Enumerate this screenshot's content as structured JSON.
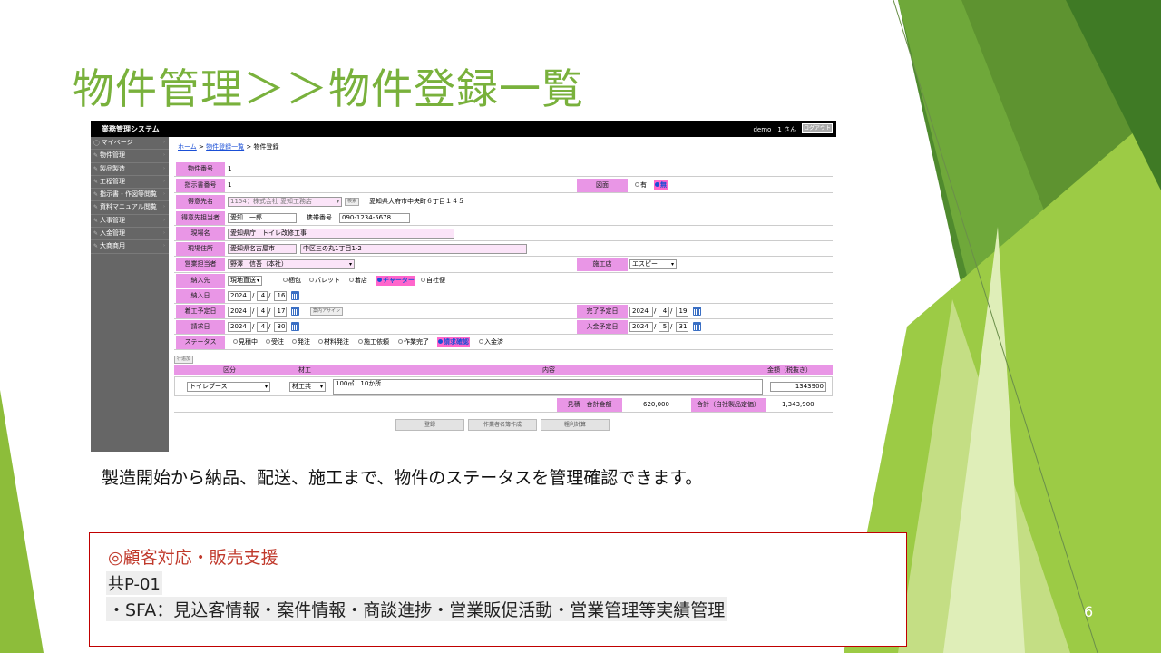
{
  "slide": {
    "title": "物件管理＞＞物件登録一覧",
    "caption": "製造開始から納品、配送、施工まで、物件のステータスを管理確認できます。",
    "note_heading": "◎顧客対応・販売支援",
    "note_code": "共P-01",
    "note_body": "・SFA：見込客情報・案件情報・商談進捗・営業販促活動・営業管理等実績管理",
    "page_number": "6",
    "accent_color": "#79b13c",
    "note_border_color": "#c00000"
  },
  "app": {
    "system_name": "業務管理システム",
    "user_label": "demo　1 さん",
    "logout_label": "ログアウト",
    "sidebar": [
      {
        "label": "マイページ"
      },
      {
        "label": "物件管理"
      },
      {
        "label": "製品製造"
      },
      {
        "label": "工程管理"
      },
      {
        "label": "指示書・作図等閲覧"
      },
      {
        "label": "資料マニュアル閲覧"
      },
      {
        "label": "人事管理"
      },
      {
        "label": "入金管理"
      },
      {
        "label": "大商商用"
      }
    ],
    "breadcrumb": {
      "home": "ホーム",
      "sep": ">",
      "list": "物件登録一覧",
      "current": "物件登録"
    },
    "form": {
      "property_no_label": "物件番号",
      "property_no": "1",
      "instruction_no_label": "指示書番号",
      "instruction_no": "1",
      "drawing_label": "図面",
      "drawing_yes": "有",
      "drawing_no": "無",
      "client_label": "得意先名",
      "client_value": "1154：株式会社 愛知工務店",
      "client_search": "検索",
      "client_address": "愛知県大府市中央町６丁目１４５",
      "client_person_label": "得意先担当者",
      "client_person": "愛知　一郎",
      "mobile_label": "携帯番号",
      "mobile": "090-1234-5678",
      "site_name_label": "現場名",
      "site_name": "愛知県庁　トイレ改修工事",
      "site_address_label": "現場住所",
      "site_city": "愛知県名古屋市",
      "site_street": "中区三の丸1丁目1-2",
      "sales_person_label": "営業担当者",
      "sales_person": "野澤　信吾（本社）",
      "contractor_label": "施工店",
      "contractor": "エスピー",
      "delivery_label": "納入先",
      "delivery_method": "現地直送",
      "delivery_options": [
        "梱包",
        "パレット",
        "着店",
        "チャーター",
        "自社便"
      ],
      "delivery_selected": "チャーター",
      "delivery_date_label": "納入日",
      "delivery_date": {
        "y": "2024",
        "m": "4",
        "d": "16"
      },
      "start_date_label": "着工予定日",
      "start_date": {
        "y": "2024",
        "m": "4",
        "d": "17"
      },
      "assign_label": "案内アサイン",
      "end_date_label": "完了予定日",
      "end_date": {
        "y": "2024",
        "m": "4",
        "d": "19"
      },
      "invoice_date_label": "請求日",
      "invoice_date": {
        "y": "2024",
        "m": "4",
        "d": "30"
      },
      "payment_date_label": "入金予定日",
      "payment_date": {
        "y": "2024",
        "m": "5",
        "d": "31"
      },
      "status_label": "ステータス",
      "status_options": [
        "見積中",
        "受注",
        "発注",
        "材料発注",
        "施工依頼",
        "作業完了",
        "請求確認",
        "入金済"
      ],
      "status_selected": "請求確認"
    },
    "detail": {
      "add_row_label": "行追加",
      "headers": {
        "category": "区分",
        "material": "材工",
        "content": "内容",
        "amount": "金額（税抜き）"
      },
      "row": {
        "category": "トイレブース",
        "material": "材工共",
        "content": "100㎡　10か所",
        "amount": "1343900"
      },
      "estimate_total_label": "見積　合計金額",
      "estimate_total": "620,000",
      "company_total_label": "合計（自社製品定価）",
      "company_total": "1,343,900"
    },
    "actions": {
      "register": "登録",
      "worker_create": "作業者名簿作成",
      "profit_calc": "粗利計算"
    }
  }
}
